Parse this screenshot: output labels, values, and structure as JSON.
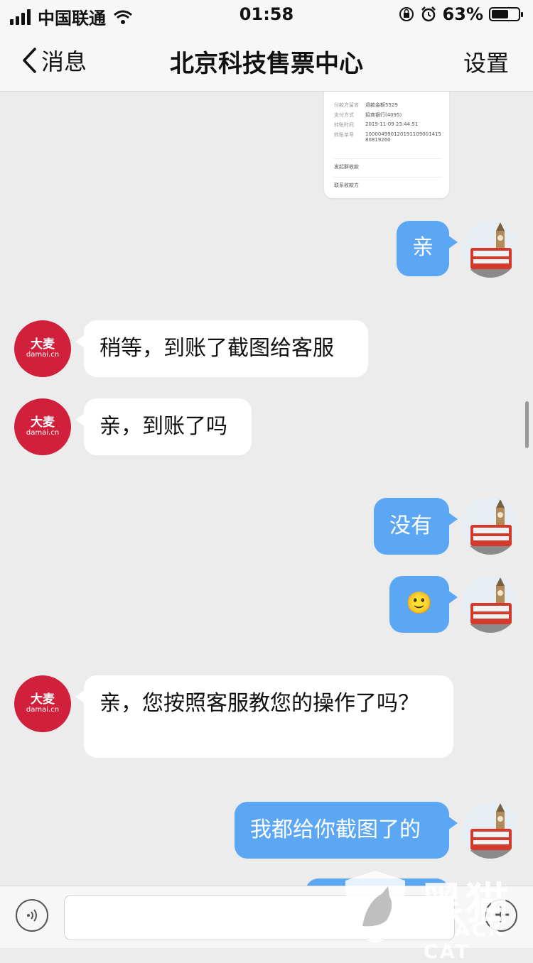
{
  "status_bar": {
    "carrier": "中国联通",
    "time": "01:58",
    "battery_percent": "63%",
    "battery_level": 0.63
  },
  "nav": {
    "back_label": "消息",
    "title": "北京科技售票中心",
    "settings_label": "设置"
  },
  "receipt": {
    "rows": [
      {
        "label": "付款方留言",
        "value": "退款金额5529"
      },
      {
        "label": "支付方式",
        "value": "招商银行(4095)"
      },
      {
        "label": "转账时间",
        "value": "2019-11-09 23:44:51"
      },
      {
        "label": "转账单号",
        "value": "10000499012019110900141580819260"
      }
    ],
    "link_group": "发起群收款",
    "link_contact": "联系收款方"
  },
  "avatar_damai": {
    "logo": "大麦",
    "domain": "damai.cn"
  },
  "messages": [
    {
      "side": "out",
      "text": "亲"
    },
    {
      "side": "in",
      "text": "稍等，到账了截图给客服"
    },
    {
      "side": "in",
      "text": "亲，到账了吗"
    },
    {
      "side": "out",
      "text": "没有"
    },
    {
      "side": "out",
      "text": "🙂"
    },
    {
      "side": "in",
      "text": "亲，您按照客服教您的操作了吗？"
    },
    {
      "side": "out",
      "text": "我都给你截图了的"
    }
  ],
  "watermark": {
    "cn": "黑猫",
    "en": "BLACK CAT"
  },
  "colors": {
    "bubble_out": "#5ba7f4",
    "bubble_in": "#ffffff",
    "damai_red": "#d0203b",
    "background": "#ececec"
  }
}
